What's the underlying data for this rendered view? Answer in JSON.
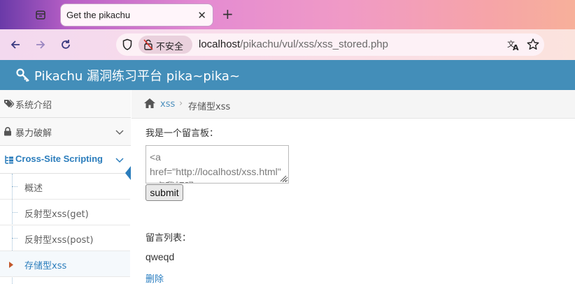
{
  "browser": {
    "tab_title": "Get the pikachu",
    "tab_close": "✕",
    "new_tab": "+",
    "security_label": "不安全",
    "url_host": "localhost",
    "url_path": "/pikachu/vul/xss/xss_stored.php"
  },
  "header": {
    "title": "Pikachu 漏洞练习平台 pika~pika~",
    "bg_color": "#438eb9"
  },
  "sidebar": {
    "items": [
      {
        "label": "系统介绍",
        "icon": "tag-icon"
      },
      {
        "label": "暴力破解",
        "icon": "lock-icon"
      },
      {
        "label": "Cross-Site Scripting",
        "icon": "tree-icon"
      }
    ],
    "sub_items": [
      {
        "label": "概述"
      },
      {
        "label": "反射型xss(get)"
      },
      {
        "label": "反射型xss(post)"
      },
      {
        "label": "存储型xss"
      }
    ],
    "accent_color": "#2b7dbc"
  },
  "breadcrumb": {
    "link": "xss",
    "separator": "›",
    "current": "存储型xss"
  },
  "main": {
    "board_label": "我是一个留言板：",
    "message_value": "<a href=\"http://localhost/xss.html\">点我好吗</a>",
    "submit_label": "submit",
    "list_label": "留言列表：",
    "messages": [
      {
        "text": "qweqd",
        "delete_label": "删除"
      }
    ]
  }
}
